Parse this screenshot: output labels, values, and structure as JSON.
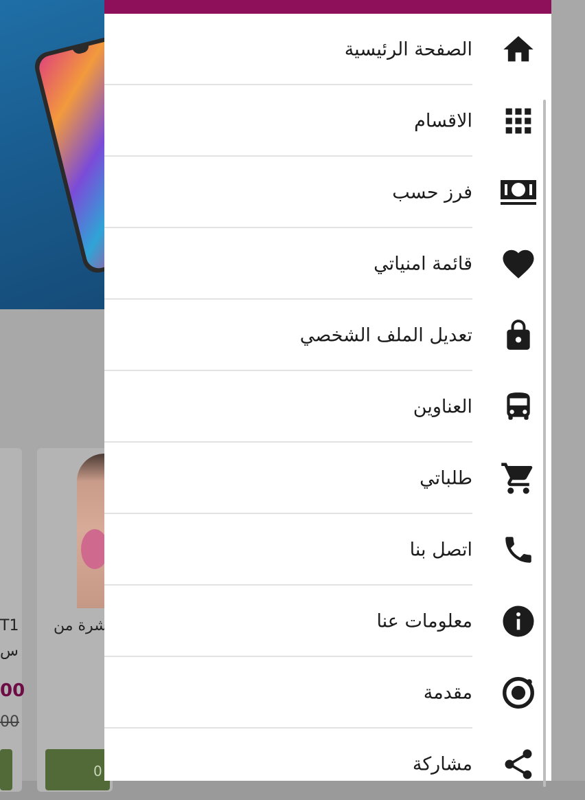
{
  "background_app": {
    "product_left": {
      "title_line1": "T1",
      "title_line2": "س",
      "price_new": "00",
      "price_old": "00"
    },
    "product_right": {
      "title": "شرة من",
      "button_text": "0"
    }
  },
  "drawer": {
    "accent_color": "#8e0f5a",
    "items": [
      {
        "label": "الصفحة الرئيسية",
        "icon": "home-icon"
      },
      {
        "label": "الاقسام",
        "icon": "grid-icon"
      },
      {
        "label": "فرز حسب",
        "icon": "money-icon"
      },
      {
        "label": "قائمة امنياتي",
        "icon": "heart-icon"
      },
      {
        "label": "تعديل الملف الشخصي",
        "icon": "lock-icon"
      },
      {
        "label": "العناوين",
        "icon": "bus-icon"
      },
      {
        "label": "طلباتي",
        "icon": "cart-icon"
      },
      {
        "label": "اتصل بنا",
        "icon": "phone-icon"
      },
      {
        "label": "معلومات عنا",
        "icon": "info-icon"
      },
      {
        "label": "مقدمة",
        "icon": "intro-icon"
      },
      {
        "label": "مشاركة",
        "icon": "share-icon"
      }
    ]
  }
}
